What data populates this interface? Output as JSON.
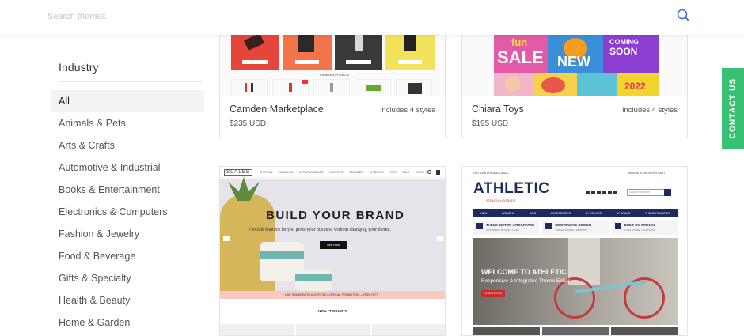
{
  "search": {
    "placeholder": "Search themes"
  },
  "sidebar": {
    "heading": "Industry",
    "items": [
      "All",
      "Animals & Pets",
      "Arts & Crafts",
      "Automotive & Industrial",
      "Books & Entertainment",
      "Electronics & Computers",
      "Fashion & Jewelry",
      "Food & Beverage",
      "Gifts & Specialty",
      "Health & Beauty",
      "Home & Garden"
    ],
    "active_index": 0
  },
  "contact_tab": {
    "label": "CONTACT US"
  },
  "themes": [
    {
      "name": "Camden Marketplace",
      "styles": "includes 4 styles",
      "price": "$235 USD",
      "preview": {
        "featured_label": "Featured Products"
      }
    },
    {
      "name": "Chiara Toys",
      "styles": "includes 4 styles",
      "price": "$195 USD",
      "preview": {
        "word1": "fun",
        "word2": "SALE",
        "word3": "NEW",
        "word4": "COMING",
        "word5": "SOON",
        "word6": "2022"
      }
    },
    {
      "name": "Scales",
      "styles": "",
      "price": "",
      "preview": {
        "logo": "SCALES",
        "nav": [
          "SHOP ALL",
          "MASQUES",
          "AFTER MASQUES",
          "RELIEVES",
          "BRONZER",
          "LIP BALMS",
          "KITS",
          "SALE",
          "MORE ⌄"
        ],
        "headline": "BUILD YOUR BRAND",
        "subline": "Flexible features let you grow your business without changing your theme.",
        "cta": "See How",
        "promo": "USE THIS AREA TO ADVERTISE A SPECIAL PROMOTION — FREE GIFT",
        "section": "NEW PRODUCTS"
      }
    },
    {
      "name": "Athletic",
      "styles": "",
      "price": "",
      "preview": {
        "top_left": "GIFT CERTIFICATES   USD ⌄",
        "top_right": "SIGN IN or REGISTER   CART",
        "logo": "ATHLETIC",
        "logo_sub": "STENCIL UPGRADE",
        "search_placeholder": "Search the store",
        "nav": [
          "NEW",
          "WOMENS",
          "KIDS",
          "ACCESSORIES",
          "BY COLORS",
          "BY BRAND",
          "THEME FEATURES"
        ],
        "features": [
          {
            "title": "THEME EDITOR INTEGRATED",
            "sub": "CUSTOMIZE WITHOUT CODE"
          },
          {
            "title": "RESPONSIVE DESIGN",
            "sub": "TABLET, PHONE & DESKTOP"
          },
          {
            "title": "BUILT ON STENCIL",
            "sub": "YOUR STORE, YOUR DATA"
          }
        ],
        "hero_title": "WELCOME TO ATHLETIC",
        "hero_sub": "Responsive & Integrated Theme Editor",
        "hero_cta": "LEARN MORE"
      }
    }
  ],
  "colors": {
    "accent": "#4a6fd1",
    "contact": "#38c172",
    "athletic_navy": "#1d2b5c",
    "promo_pink": "#f8c9c0"
  }
}
